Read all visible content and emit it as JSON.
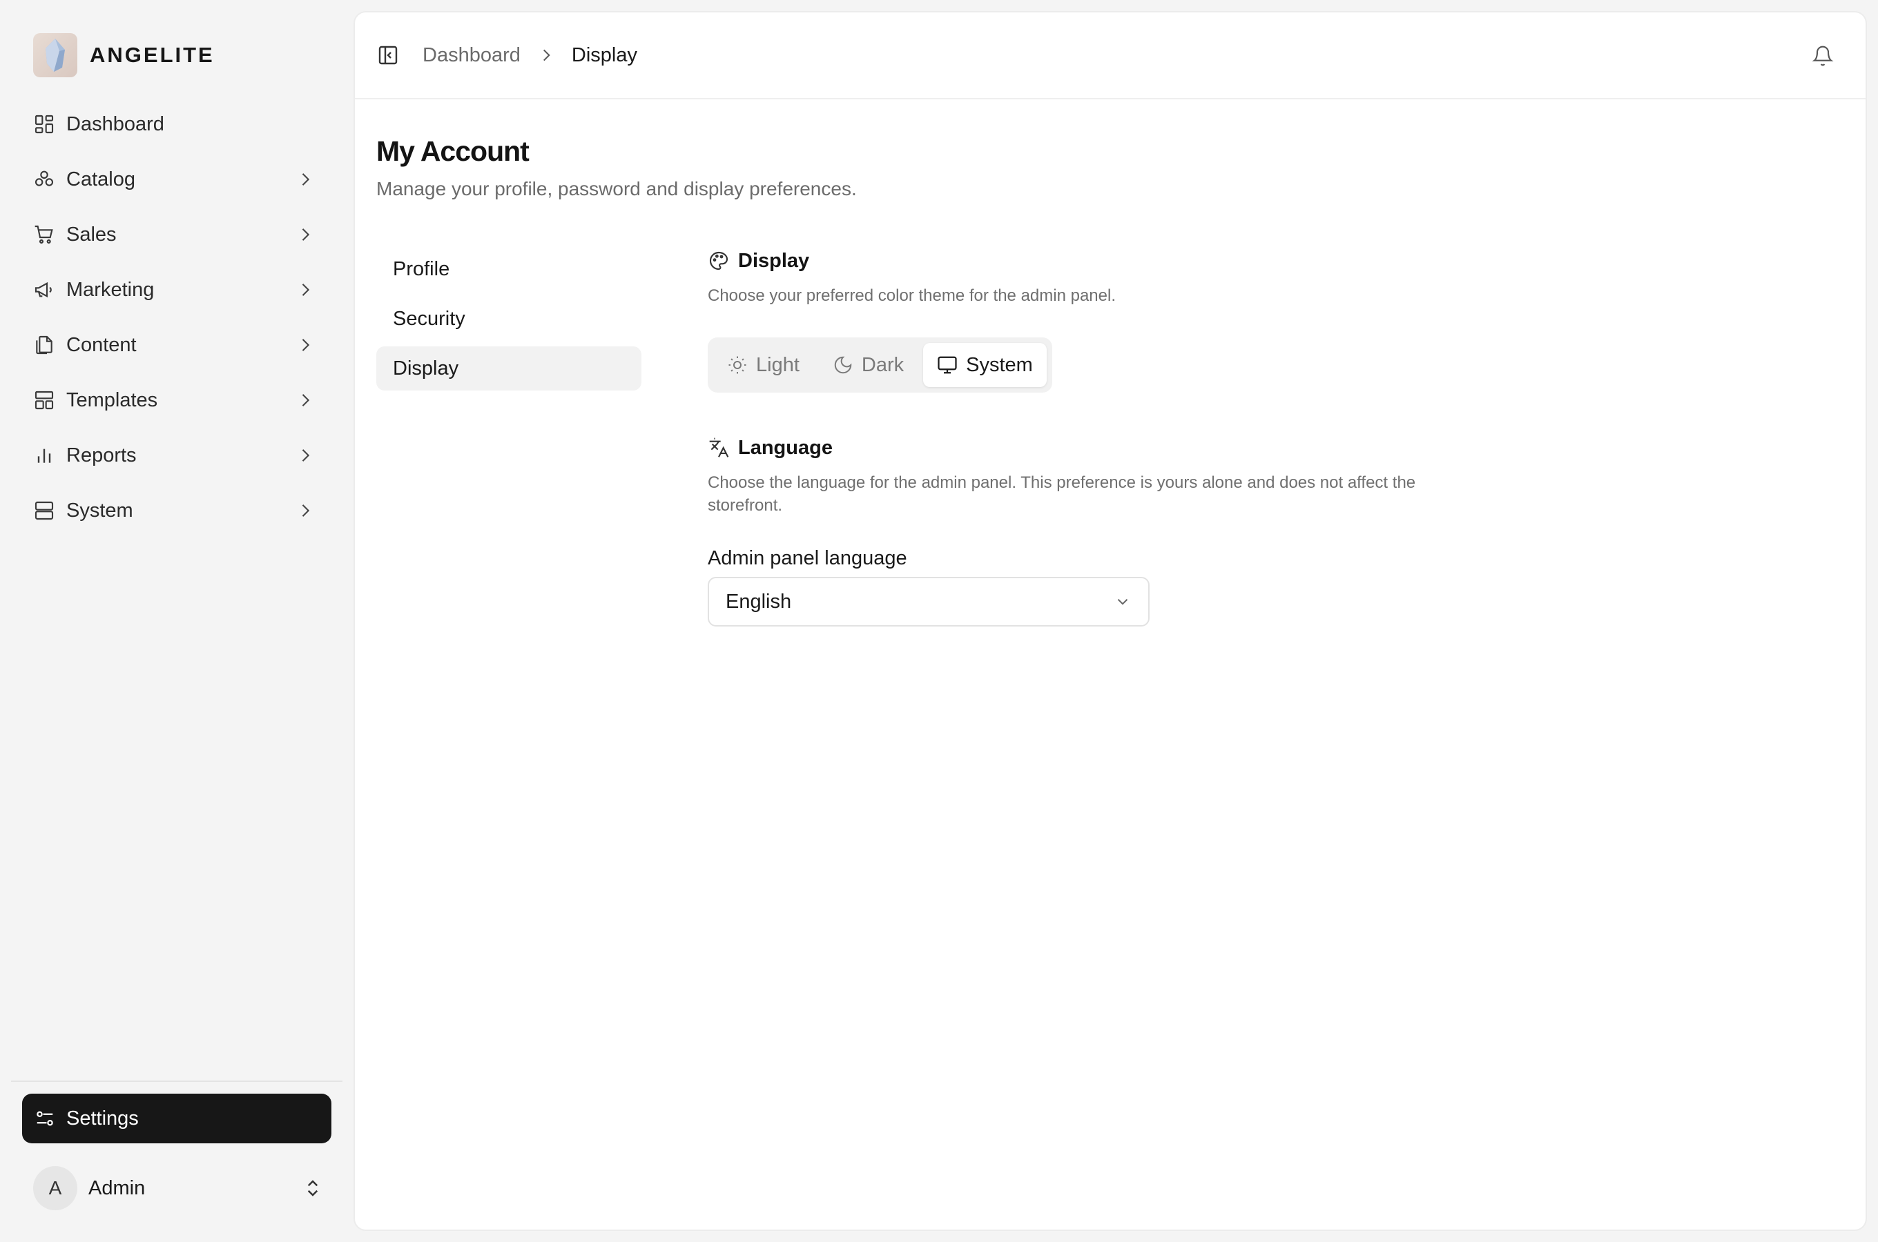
{
  "brand": {
    "name": "ANGELITE",
    "logo_icon": "crystal-logo"
  },
  "sidebar": {
    "items": [
      {
        "label": "Dashboard",
        "icon": "dashboard-icon",
        "has_children": false
      },
      {
        "label": "Catalog",
        "icon": "catalog-icon",
        "has_children": true
      },
      {
        "label": "Sales",
        "icon": "cart-icon",
        "has_children": true
      },
      {
        "label": "Marketing",
        "icon": "megaphone-icon",
        "has_children": true
      },
      {
        "label": "Content",
        "icon": "files-icon",
        "has_children": true
      },
      {
        "label": "Templates",
        "icon": "layout-icon",
        "has_children": true
      },
      {
        "label": "Reports",
        "icon": "chart-icon",
        "has_children": true
      },
      {
        "label": "System",
        "icon": "server-icon",
        "has_children": true
      }
    ],
    "settings_label": "Settings",
    "user": {
      "initial": "A",
      "name": "Admin"
    }
  },
  "header": {
    "breadcrumb": {
      "parent": "Dashboard",
      "current": "Display"
    }
  },
  "page": {
    "title": "My Account",
    "subtitle": "Manage your profile, password and display preferences."
  },
  "subnav": {
    "items": [
      {
        "label": "Profile",
        "active": false
      },
      {
        "label": "Security",
        "active": false
      },
      {
        "label": "Display",
        "active": true
      }
    ]
  },
  "display_section": {
    "title": "Display",
    "description": "Choose your preferred color theme for the admin panel.",
    "theme_options": [
      {
        "label": "Light",
        "icon": "sun-icon",
        "active": false
      },
      {
        "label": "Dark",
        "icon": "moon-icon",
        "active": false
      },
      {
        "label": "System",
        "icon": "monitor-icon",
        "active": true
      }
    ]
  },
  "language_section": {
    "title": "Language",
    "description": "Choose the language for the admin panel. This preference is yours alone and does not affect the storefront.",
    "field_label": "Admin panel language",
    "selected_value": "English"
  },
  "colors": {
    "active_button_bg": "#171717",
    "page_bg": "#f4f4f4",
    "panel_bg": "#ffffff"
  }
}
